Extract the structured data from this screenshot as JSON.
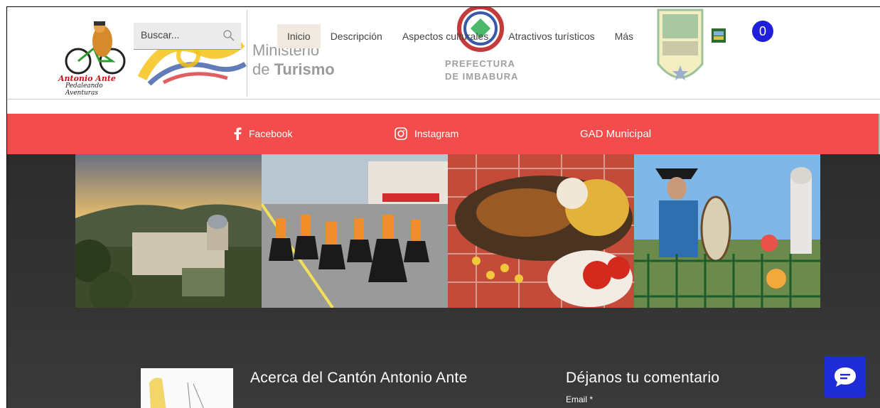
{
  "logo": {
    "line1": "Antonio Ante",
    "line2": "Pedaleando Aventuras"
  },
  "search": {
    "placeholder": "Buscar..."
  },
  "ministerio": {
    "line1": "Ministerio",
    "line2_prefix": "de ",
    "line2_bold": "Turismo"
  },
  "nav": {
    "items": [
      {
        "label": "Inicio",
        "active": true
      },
      {
        "label": "Descripción",
        "active": false
      },
      {
        "label": "Aspectos culturales",
        "active": false
      },
      {
        "label": "Atractivos turísticos",
        "active": false
      },
      {
        "label": "Más",
        "active": false
      }
    ]
  },
  "prefectura": {
    "line1": "PREFECTURA",
    "line2": "DE IMBABURA"
  },
  "cart": {
    "count": "0"
  },
  "social": {
    "facebook": "Facebook",
    "instagram": "Instagram",
    "gad": "GAD Municipal"
  },
  "gallery": {
    "images": [
      "city-sunset-photo",
      "dancers-parade-photo",
      "food-dish-photo",
      "musician-park-photo"
    ]
  },
  "about": {
    "title": "Acerca del Cantón Antonio Ante"
  },
  "comment": {
    "title": "Déjanos tu comentario",
    "email_label": "Email *"
  },
  "colors": {
    "social_bar": "#f24c4c",
    "chat": "#1e2cd8",
    "cart": "#1f1fd8",
    "dark_bg": "#2c2c2c"
  }
}
